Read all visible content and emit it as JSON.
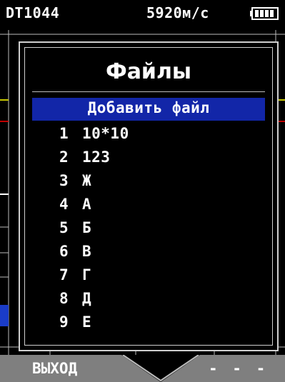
{
  "status": {
    "device": "DT1044",
    "speed": "5920м/с",
    "battery_icon": "battery-full-icon"
  },
  "dialog": {
    "title": "Файлы",
    "add_file": "Добавить файл",
    "files": [
      {
        "num": "1",
        "name": "10*10"
      },
      {
        "num": "2",
        "name": "123"
      },
      {
        "num": "3",
        "name": "Ж"
      },
      {
        "num": "4",
        "name": "А"
      },
      {
        "num": "5",
        "name": "Б"
      },
      {
        "num": "6",
        "name": "В"
      },
      {
        "num": "7",
        "name": "Г"
      },
      {
        "num": "8",
        "name": "Д"
      },
      {
        "num": "9",
        "name": "Е"
      }
    ]
  },
  "bottom": {
    "exit": "ВЫХОД",
    "dashes": "- - -"
  },
  "colors": {
    "highlight": "#1226a8",
    "bottom_bar": "#7f7f7f",
    "trace_yellow": "#c8c800",
    "trace_red": "#c00000",
    "accent_blue": "#1a3cc8"
  }
}
